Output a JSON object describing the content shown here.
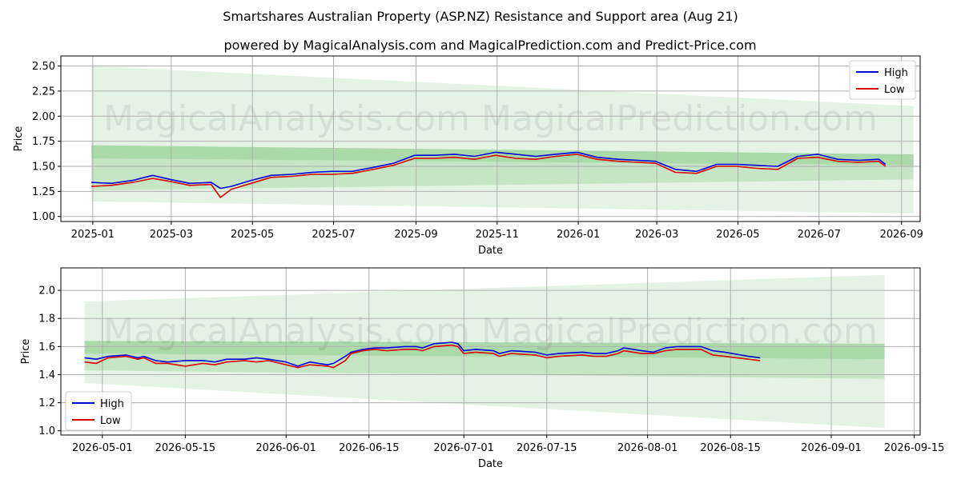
{
  "title": "Smartshares Australian Property (ASP.NZ) Resistance and Support area (Aug 21)",
  "subtitle": "powered by MagicalAnalysis.com and MagicalPrediction.com and Predict-Price.com",
  "watermark": "MagicalAnalysis.com    MagicalPrediction.com",
  "colors": {
    "high": "#0000dd",
    "low": "#dd0000",
    "band": "#2ca02c"
  },
  "chart_data": [
    {
      "type": "line",
      "xlabel": "Date",
      "ylabel": "Price",
      "xlim": [
        "2024-12-08",
        "2026-09-15"
      ],
      "ylim": [
        0.95,
        2.6
      ],
      "xticks": [
        "2025-01",
        "2025-03",
        "2025-05",
        "2025-07",
        "2025-09",
        "2025-11",
        "2026-01",
        "2026-03",
        "2026-05",
        "2026-07",
        "2026-09"
      ],
      "yticks": [
        "1.00",
        "1.25",
        "1.50",
        "1.75",
        "2.00",
        "2.25",
        "2.50"
      ],
      "legend": {
        "position": "top-right",
        "entries": [
          "High",
          "Low"
        ]
      },
      "grid": true,
      "x": [
        "2024-12-31",
        "2025-01-15",
        "2025-01-31",
        "2025-02-15",
        "2025-02-28",
        "2025-03-15",
        "2025-03-31",
        "2025-04-07",
        "2025-04-15",
        "2025-04-30",
        "2025-05-15",
        "2025-05-31",
        "2025-06-15",
        "2025-06-30",
        "2025-07-15",
        "2025-07-31",
        "2025-08-15",
        "2025-08-31",
        "2025-09-15",
        "2025-09-30",
        "2025-10-15",
        "2025-10-31",
        "2025-11-15",
        "2025-11-30",
        "2025-12-15",
        "2025-12-31",
        "2026-01-15",
        "2026-01-31",
        "2026-02-15",
        "2026-02-28",
        "2026-03-15",
        "2026-03-31",
        "2026-04-15",
        "2026-04-30",
        "2026-05-15",
        "2026-05-31",
        "2026-06-15",
        "2026-06-30",
        "2026-07-15",
        "2026-07-31",
        "2026-08-15",
        "2026-08-20"
      ],
      "series": [
        {
          "name": "High",
          "values": [
            1.34,
            1.33,
            1.36,
            1.41,
            1.37,
            1.33,
            1.34,
            1.28,
            1.3,
            1.36,
            1.41,
            1.42,
            1.44,
            1.45,
            1.45,
            1.49,
            1.53,
            1.61,
            1.61,
            1.62,
            1.6,
            1.64,
            1.62,
            1.6,
            1.62,
            1.64,
            1.59,
            1.57,
            1.56,
            1.55,
            1.47,
            1.45,
            1.52,
            1.52,
            1.51,
            1.5,
            1.6,
            1.62,
            1.57,
            1.56,
            1.57,
            1.52
          ]
        },
        {
          "name": "Low",
          "values": [
            1.3,
            1.31,
            1.34,
            1.38,
            1.35,
            1.31,
            1.32,
            1.19,
            1.27,
            1.33,
            1.39,
            1.4,
            1.42,
            1.42,
            1.43,
            1.47,
            1.51,
            1.58,
            1.58,
            1.59,
            1.57,
            1.61,
            1.58,
            1.57,
            1.6,
            1.62,
            1.57,
            1.55,
            1.54,
            1.53,
            1.44,
            1.43,
            1.5,
            1.5,
            1.48,
            1.47,
            1.58,
            1.59,
            1.55,
            1.54,
            1.55,
            1.5
          ]
        }
      ],
      "bands": [
        {
          "x": [
            "2024-12-31",
            "2026-09-10"
          ],
          "upper": [
            2.5,
            2.1
          ],
          "lower": [
            1.15,
            1.03
          ]
        },
        {
          "x": [
            "2024-12-31",
            "2026-09-10"
          ],
          "upper": [
            1.71,
            1.62
          ],
          "lower": [
            1.26,
            1.37
          ]
        },
        {
          "x": [
            "2024-12-31",
            "2026-09-10"
          ],
          "upper": [
            1.71,
            1.62
          ],
          "lower": [
            1.58,
            1.51
          ]
        }
      ]
    },
    {
      "type": "line",
      "xlabel": "Date",
      "ylabel": "Price",
      "xlim": [
        "2026-04-24",
        "2026-09-16"
      ],
      "ylim": [
        0.97,
        2.16
      ],
      "xticks": [
        "2026-05-01",
        "2026-05-15",
        "2026-06-01",
        "2026-06-15",
        "2026-07-01",
        "2026-07-15",
        "2026-08-01",
        "2026-08-15",
        "2026-09-01",
        "2026-09-15"
      ],
      "yticks": [
        "1.0",
        "1.2",
        "1.4",
        "1.6",
        "1.8",
        "2.0"
      ],
      "legend": {
        "position": "bottom-left",
        "entries": [
          "High",
          "Low"
        ]
      },
      "grid": true,
      "x": [
        "2026-04-28",
        "2026-04-30",
        "2026-05-02",
        "2026-05-05",
        "2026-05-07",
        "2026-05-08",
        "2026-05-10",
        "2026-05-12",
        "2026-05-15",
        "2026-05-18",
        "2026-05-20",
        "2026-05-22",
        "2026-05-25",
        "2026-05-27",
        "2026-05-29",
        "2026-06-01",
        "2026-06-03",
        "2026-06-05",
        "2026-06-08",
        "2026-06-09",
        "2026-06-11",
        "2026-06-12",
        "2026-06-14",
        "2026-06-16",
        "2026-06-18",
        "2026-06-21",
        "2026-06-23",
        "2026-06-24",
        "2026-06-26",
        "2026-06-29",
        "2026-06-30",
        "2026-07-01",
        "2026-07-03",
        "2026-07-06",
        "2026-07-07",
        "2026-07-09",
        "2026-07-13",
        "2026-07-15",
        "2026-07-17",
        "2026-07-21",
        "2026-07-23",
        "2026-07-25",
        "2026-07-27",
        "2026-07-28",
        "2026-07-31",
        "2026-08-02",
        "2026-08-04",
        "2026-08-06",
        "2026-08-10",
        "2026-08-12",
        "2026-08-14",
        "2026-08-18",
        "2026-08-20"
      ],
      "series": [
        {
          "name": "High",
          "values": [
            1.52,
            1.51,
            1.53,
            1.54,
            1.52,
            1.53,
            1.5,
            1.49,
            1.5,
            1.5,
            1.49,
            1.51,
            1.51,
            1.52,
            1.51,
            1.49,
            1.46,
            1.49,
            1.47,
            1.48,
            1.53,
            1.56,
            1.58,
            1.59,
            1.59,
            1.6,
            1.6,
            1.59,
            1.62,
            1.63,
            1.62,
            1.57,
            1.58,
            1.57,
            1.55,
            1.57,
            1.56,
            1.54,
            1.55,
            1.56,
            1.55,
            1.55,
            1.57,
            1.59,
            1.57,
            1.56,
            1.59,
            1.6,
            1.6,
            1.57,
            1.56,
            1.53,
            1.52
          ]
        },
        {
          "name": "Low",
          "values": [
            1.49,
            1.48,
            1.52,
            1.53,
            1.51,
            1.52,
            1.48,
            1.48,
            1.46,
            1.48,
            1.47,
            1.49,
            1.5,
            1.49,
            1.5,
            1.47,
            1.45,
            1.47,
            1.46,
            1.45,
            1.5,
            1.55,
            1.57,
            1.58,
            1.57,
            1.58,
            1.58,
            1.57,
            1.6,
            1.61,
            1.6,
            1.55,
            1.56,
            1.55,
            1.53,
            1.55,
            1.54,
            1.52,
            1.53,
            1.54,
            1.53,
            1.53,
            1.55,
            1.57,
            1.55,
            1.55,
            1.57,
            1.58,
            1.58,
            1.54,
            1.53,
            1.51,
            1.5
          ]
        }
      ],
      "bands": [
        {
          "x": [
            "2026-04-28",
            "2026-09-10"
          ],
          "upper": [
            1.92,
            2.11
          ],
          "lower": [
            1.34,
            1.02
          ]
        },
        {
          "x": [
            "2026-04-28",
            "2026-09-10"
          ],
          "upper": [
            1.64,
            1.62
          ],
          "lower": [
            1.43,
            1.37
          ]
        },
        {
          "x": [
            "2026-04-28",
            "2026-09-10"
          ],
          "upper": [
            1.64,
            1.62
          ],
          "lower": [
            1.55,
            1.51
          ]
        }
      ]
    }
  ]
}
